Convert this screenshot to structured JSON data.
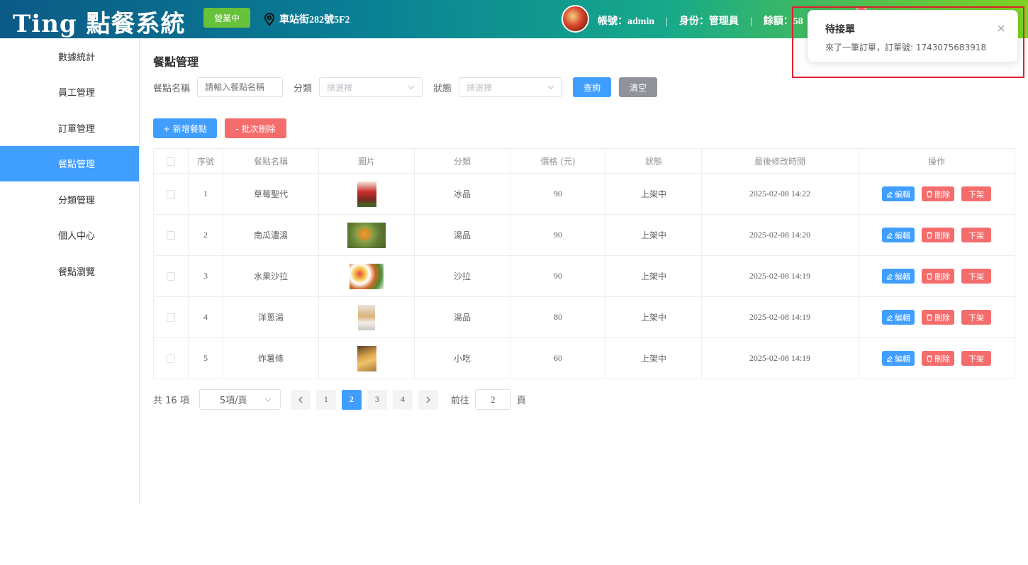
{
  "header": {
    "brand": "Ting 點餐系統",
    "status_badge": "營業中",
    "address": "車站街282號5F2",
    "account_label": "帳號：admin",
    "role_label": "身份：管理員",
    "balance_label": "餘額：58",
    "sep": "|"
  },
  "sidebar": {
    "items": [
      {
        "label": "數據統計"
      },
      {
        "label": "員工管理"
      },
      {
        "label": "訂單管理"
      },
      {
        "label": "餐點管理"
      },
      {
        "label": "分類管理"
      },
      {
        "label": "個人中心"
      },
      {
        "label": "餐點瀏覽"
      }
    ],
    "active_index": 3
  },
  "page": {
    "title": "餐點管理"
  },
  "filter": {
    "name_label": "餐點名稱",
    "name_placeholder": "請輸入餐點名稱",
    "category_label": "分類",
    "category_placeholder": "請選擇",
    "status_label": "狀態",
    "status_placeholder": "請選擇",
    "query_button": "查詢",
    "clear_button": "清空"
  },
  "toolbar": {
    "add_button": "+ 新增餐點",
    "batch_delete_button": "- 批次刪除"
  },
  "table": {
    "columns": [
      "序號",
      "餐點名稱",
      "圖片",
      "分類",
      "價格 (元)",
      "狀態",
      "最後修改時間",
      "操作"
    ],
    "rows": [
      {
        "no": "1",
        "name": "草莓聖代",
        "category": "冰品",
        "price": "90",
        "status": "上架中",
        "updated": "2025-02-08 14:22"
      },
      {
        "no": "2",
        "name": "南瓜濃湯",
        "category": "湯品",
        "price": "90",
        "status": "上架中",
        "updated": "2025-02-08 14:20"
      },
      {
        "no": "3",
        "name": "水果沙拉",
        "category": "沙拉",
        "price": "90",
        "status": "上架中",
        "updated": "2025-02-08 14:19"
      },
      {
        "no": "4",
        "name": "洋蔥湯",
        "category": "湯品",
        "price": "80",
        "status": "上架中",
        "updated": "2025-02-08 14:19"
      },
      {
        "no": "5",
        "name": "炸薯條",
        "category": "小吃",
        "price": "60",
        "status": "上架中",
        "updated": "2025-02-08 14:19"
      }
    ],
    "edit_label": "編輯",
    "delete_label": "刪除",
    "offshelf_label": "下架"
  },
  "pagination": {
    "total": "共 16 項",
    "page_size": "5項/頁",
    "pages": [
      "1",
      "2",
      "3",
      "4"
    ],
    "current": "2",
    "goto_prefix": "前往",
    "goto_value": "2",
    "goto_suffix": "頁"
  },
  "notification": {
    "title": "待接單",
    "message": "來了一筆訂單，訂單號: 1743075683918"
  }
}
